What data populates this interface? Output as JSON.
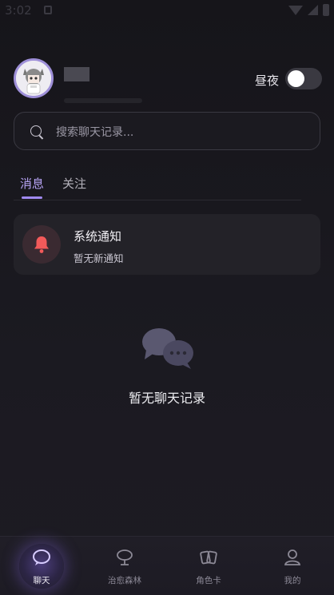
{
  "status_bar": {
    "time": "3:02"
  },
  "profile": {
    "daynight_label": "昼夜",
    "daynight_on": false
  },
  "search": {
    "placeholder": "搜索聊天记录..."
  },
  "tabs": [
    {
      "label": "消息",
      "active": true
    },
    {
      "label": "关注",
      "active": false
    }
  ],
  "notification": {
    "title": "系统通知",
    "subtitle": "暂无新通知"
  },
  "empty_state": {
    "text": "暂无聊天记录"
  },
  "bottom_nav": [
    {
      "label": "聊天",
      "icon": "chat-bubble-icon",
      "active": true
    },
    {
      "label": "治愈森林",
      "icon": "tree-icon",
      "active": false
    },
    {
      "label": "角色卡",
      "icon": "cards-icon",
      "active": false
    },
    {
      "label": "我的",
      "icon": "profile-icon",
      "active": false
    }
  ],
  "colors": {
    "accent": "#a08af0",
    "bell": "#f25a5a",
    "background": "#16151a"
  }
}
